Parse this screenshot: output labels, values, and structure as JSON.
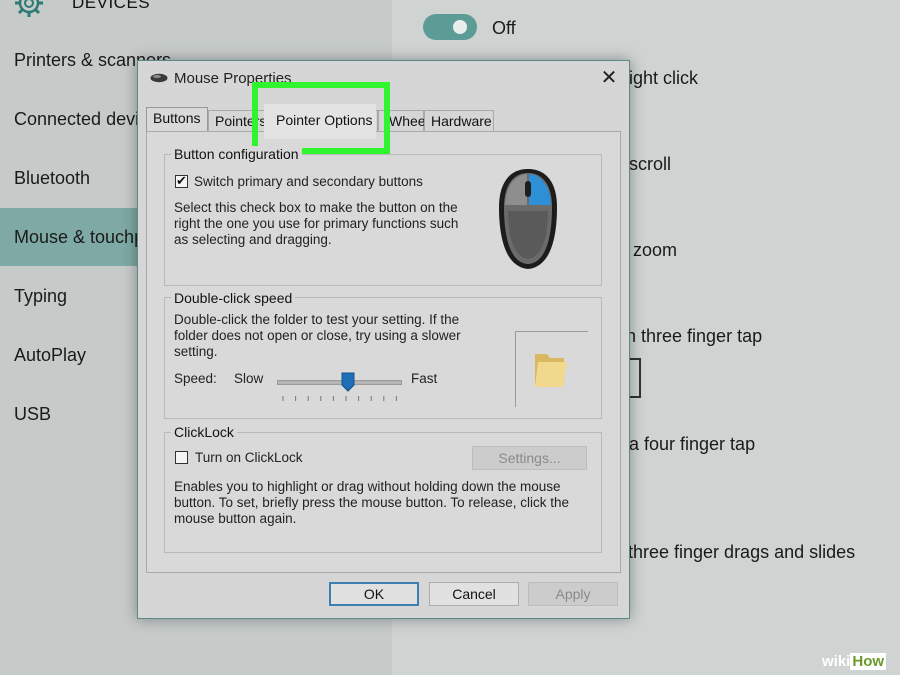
{
  "settings": {
    "header_title": "DEVICES",
    "nav_items": [
      "Printers & scanners",
      "Connected devices",
      "Bluetooth",
      "Mouse & touchpad",
      "Typing",
      "AutoPlay",
      "USB"
    ],
    "active_nav_index": 3,
    "toggle_label": "Off",
    "right_texts": [
      "ight click",
      "scroll",
      "zoom",
      "n three finger tap",
      "a four finger tap",
      "three finger drags and slides"
    ]
  },
  "dialog": {
    "title": "Mouse Properties",
    "close_symbol": "✕",
    "tabs": [
      "Buttons",
      "Pointers",
      "Pointer Options",
      "Wheel",
      "Hardware"
    ],
    "selected_tab": "Buttons",
    "highlighted_tab": "Pointer Options",
    "button_config": {
      "title": "Button configuration",
      "checkbox_label": "Switch primary and secondary buttons",
      "checked": true,
      "description_lines": [
        "Select this check box to make the button on the",
        "right the one you use for primary functions such",
        "as selecting and dragging."
      ]
    },
    "double_click": {
      "title": "Double-click speed",
      "description_lines": [
        "Double-click the folder to test your setting. If the",
        "folder does not open or close, try using a slower",
        "setting."
      ],
      "speed_label": "Speed:",
      "slow_label": "Slow",
      "fast_label": "Fast",
      "speed_fraction": 0.58
    },
    "clicklock": {
      "title": "ClickLock",
      "checkbox_label": "Turn on ClickLock",
      "checked": false,
      "settings_button": "Settings...",
      "description_lines": [
        "Enables you to highlight or drag without holding down the mouse",
        "button. To set, briefly press the mouse button. To release, click the",
        "mouse button again."
      ]
    },
    "buttons": {
      "ok": "OK",
      "cancel": "Cancel",
      "apply": "Apply"
    }
  },
  "watermark": {
    "wiki": "wiki",
    "how": "How"
  },
  "colors": {
    "highlight": "#2ef52e",
    "active_nav": "#7fa9a5",
    "accent": "#3c7fb1",
    "mouse_button": "#2d8fd5"
  }
}
